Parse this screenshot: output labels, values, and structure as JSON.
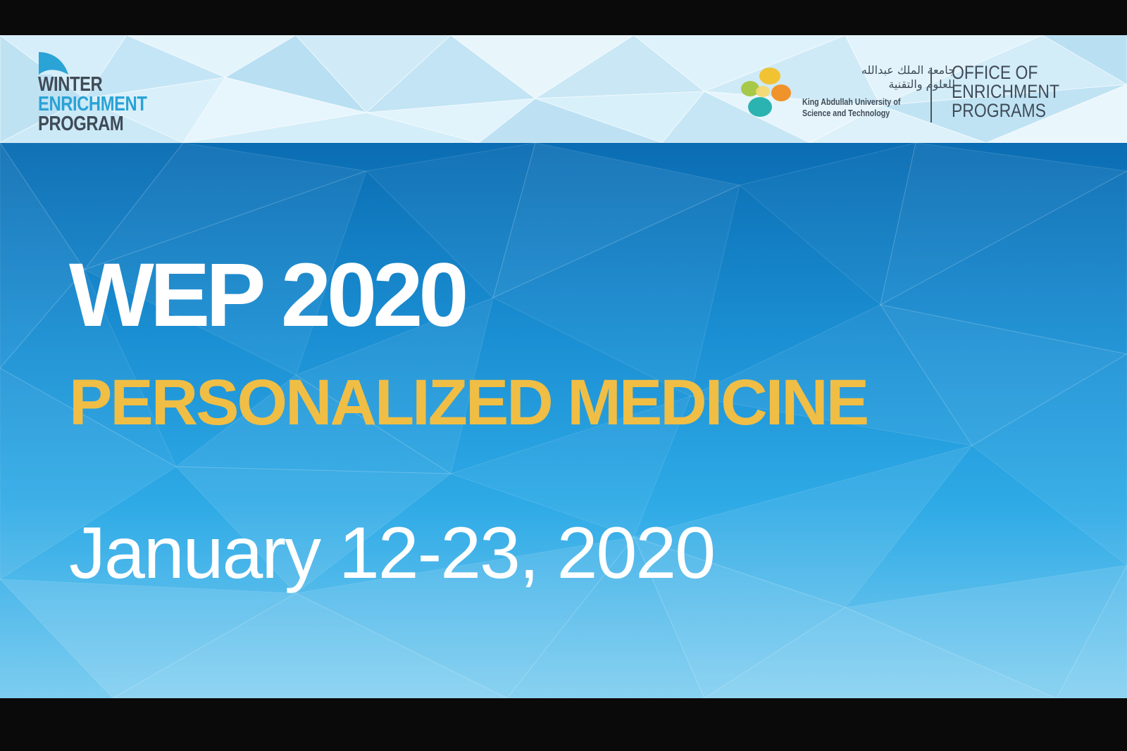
{
  "header": {
    "program_logo": {
      "line1": "WINTER",
      "line2": "ENRICHMENT",
      "line3": "PROGRAM"
    },
    "university_logo": {
      "arabic_line1": "جامعة الملك عبدالله",
      "arabic_line2": "للعلوم والتقنية",
      "english_line1": "King Abdullah University of",
      "english_line2": "Science and Technology"
    },
    "office": {
      "line1": "OFFICE OF",
      "line2": "ENRICHMENT",
      "line3": "PROGRAMS"
    }
  },
  "main": {
    "title": "WEP 2020",
    "subtitle": "PERSONALIZED MEDICINE",
    "dates": "January 12-23, 2020"
  },
  "colors": {
    "title": "#ffffff",
    "subtitle": "#f0be45",
    "logo_dark": "#3f4b57",
    "logo_blue": "#2aa3d6",
    "panel_top": "#0b6db3",
    "panel_bottom": "#7dcdf0"
  },
  "icons": {
    "program_mark": "wave-arc-icon",
    "university_mark": "kaust-spheres-icon"
  }
}
